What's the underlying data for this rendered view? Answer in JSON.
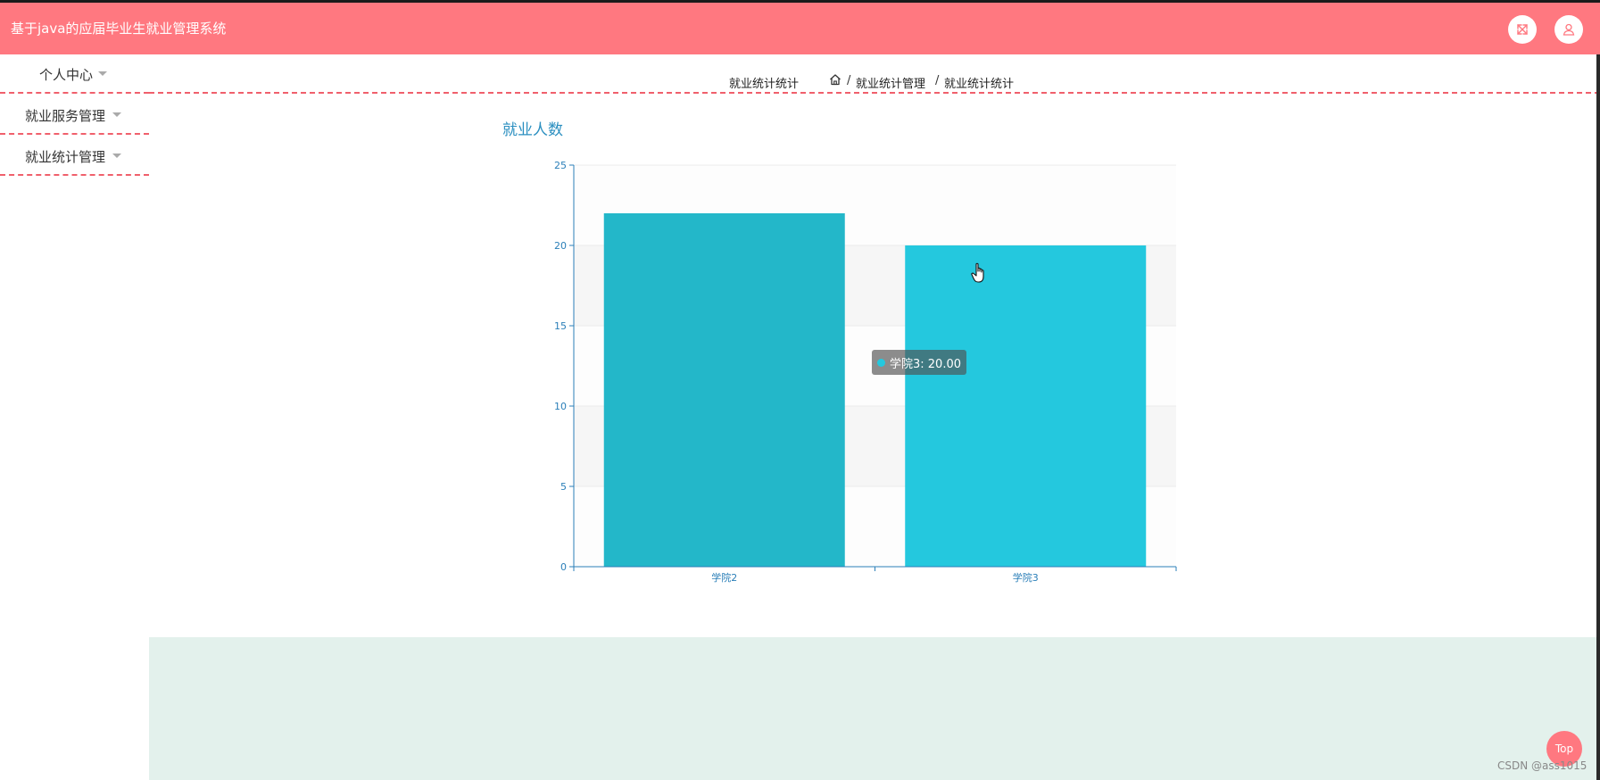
{
  "app": {
    "title": "基于java的应届毕业生就业管理系统"
  },
  "header": {
    "fullscreen_icon": "fullscreen-icon",
    "user_icon": "user-icon"
  },
  "sidebar": {
    "items": [
      {
        "label": "个人中心"
      },
      {
        "label": "就业服务管理"
      },
      {
        "label": "就业统计管理"
      }
    ]
  },
  "breadcrumb": {
    "page_label": "就业统计统计",
    "home_icon": "home-icon",
    "separator": "/",
    "parent": "就业统计管理",
    "current": "就业统计统计"
  },
  "chart_title": "就业人数",
  "chart_data": {
    "type": "bar",
    "title": "就业人数",
    "categories": [
      "学院2",
      "学院3"
    ],
    "values": [
      22,
      20
    ],
    "bar_colors": [
      "#23b7c9",
      "#24c8de"
    ],
    "ylim": [
      0,
      25
    ],
    "yticks": [
      0,
      5,
      10,
      15,
      20,
      25
    ],
    "grid": true,
    "axis_color": "#2b7fb8"
  },
  "tooltip": {
    "text": "学院3: 20.00",
    "dot_color": "#24c8de"
  },
  "footer": {
    "top_button": "Top",
    "watermark": "CSDN @ass1015"
  },
  "colors": {
    "brand": "#ff7880",
    "accent": "#2b8fc0",
    "footer_band": "#e3f1ec"
  }
}
